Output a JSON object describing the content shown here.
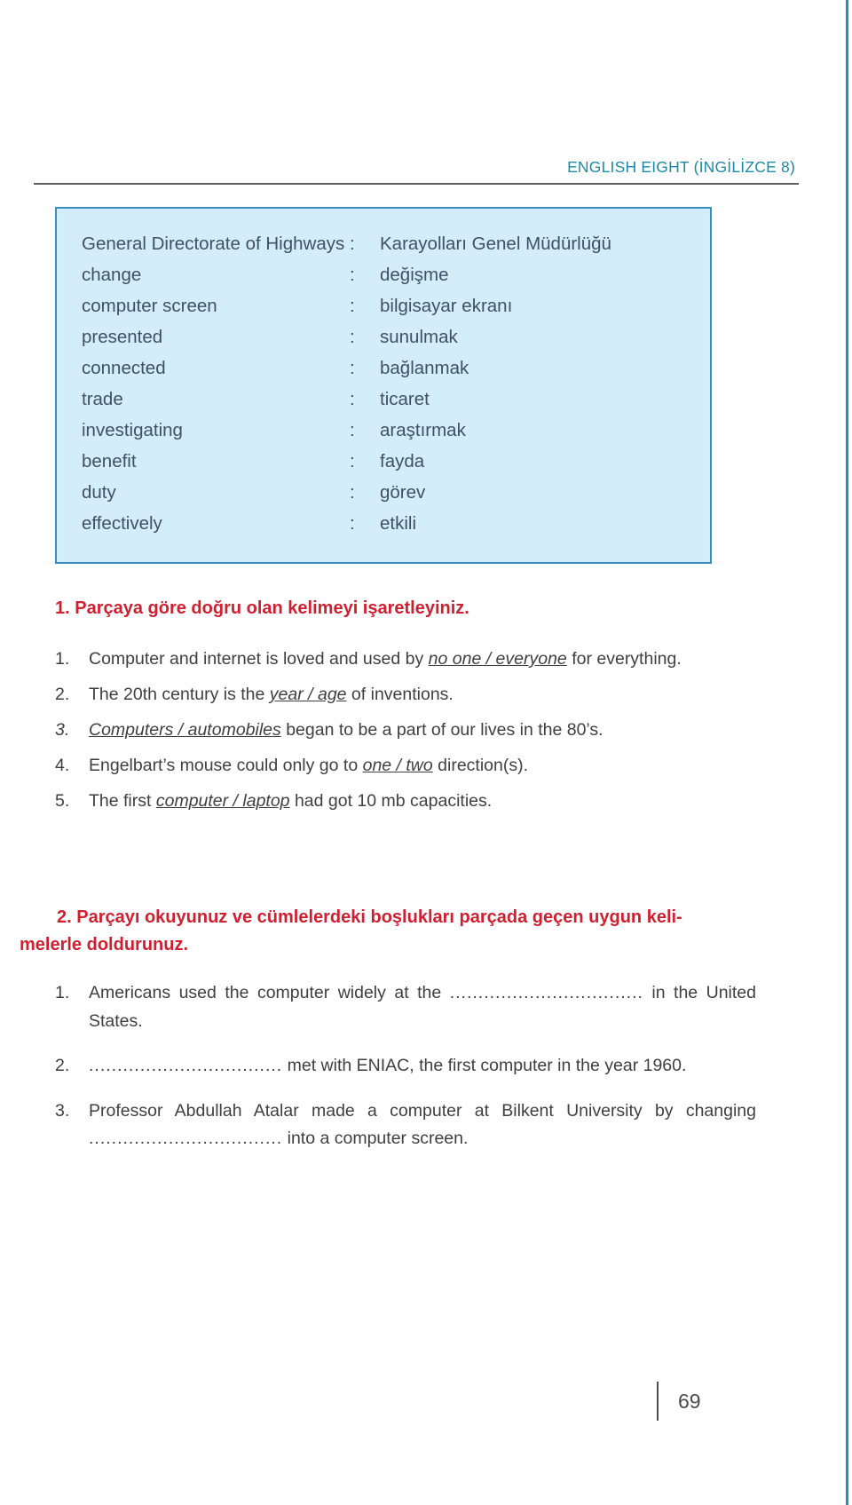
{
  "header": {
    "title": "ENGLISH EIGHT (İNGİLİZCE 8)"
  },
  "vocabulary": {
    "separator": ":",
    "rows": [
      {
        "en": "General Directorate of Highways",
        "tr": "Karayolları Genel Müdürlüğü"
      },
      {
        "en": "change",
        "tr": "değişme"
      },
      {
        "en": "computer screen",
        "tr": "bilgisayar ekranı"
      },
      {
        "en": "presented",
        "tr": "sunulmak"
      },
      {
        "en": "connected",
        "tr": "bağlanmak"
      },
      {
        "en": "trade",
        "tr": "ticaret"
      },
      {
        "en": "investigating",
        "tr": "araştırmak"
      },
      {
        "en": "benefit",
        "tr": "fayda"
      },
      {
        "en": "duty",
        "tr": "görev"
      },
      {
        "en": "effectively",
        "tr": "etkili"
      }
    ]
  },
  "exercise1": {
    "heading": "1. Parçaya göre doğru olan kelimeyi işaretleyiniz.",
    "items": [
      {
        "number": "1.",
        "before": "Computer and internet is loved and used by ",
        "choice": "no one / everyone",
        "after": " for everything."
      },
      {
        "number": "2.",
        "before": "The 20th century is the ",
        "choice": "year / age",
        "after": " of inventions."
      },
      {
        "number": "3.",
        "before": "",
        "choice": "Computers / automobiles",
        "after": " began to be a part of our lives in the 80’s."
      },
      {
        "number": "4.",
        "before": "Engelbart’s mouse could only go to ",
        "choice": "one / two",
        "after": " direction(s)."
      },
      {
        "number": "5.",
        "before": "The first ",
        "choice": "computer / laptop",
        "after": " had got 10 mb capacities."
      }
    ]
  },
  "exercise2": {
    "heading_line1": "2. Parçayı okuyunuz ve cümlelerdeki boşlukları parçada geçen uygun  keli-",
    "heading_line2": "melerle  doldurunuz.",
    "blank": "..................................",
    "items": [
      {
        "number": "1.",
        "before": "Americans used the computer widely at the ",
        "after": " in the United States."
      },
      {
        "number": "2.",
        "before": "",
        "after": " met with ENIAC, the first computer in the year 1960."
      },
      {
        "number": "3.",
        "before": "Professor Abdullah Atalar made a computer at Bilkent University by changing ",
        "after": " into a computer screen."
      }
    ]
  },
  "footer": {
    "page_number": "69"
  },
  "colors": {
    "header_teal": "#1b8aa8",
    "box_fill": "#d4edfa",
    "box_border": "#3b8fbd",
    "heading_red": "#cf2030",
    "body_text": "#3f3f3f",
    "vocab_text": "#3f5165"
  }
}
